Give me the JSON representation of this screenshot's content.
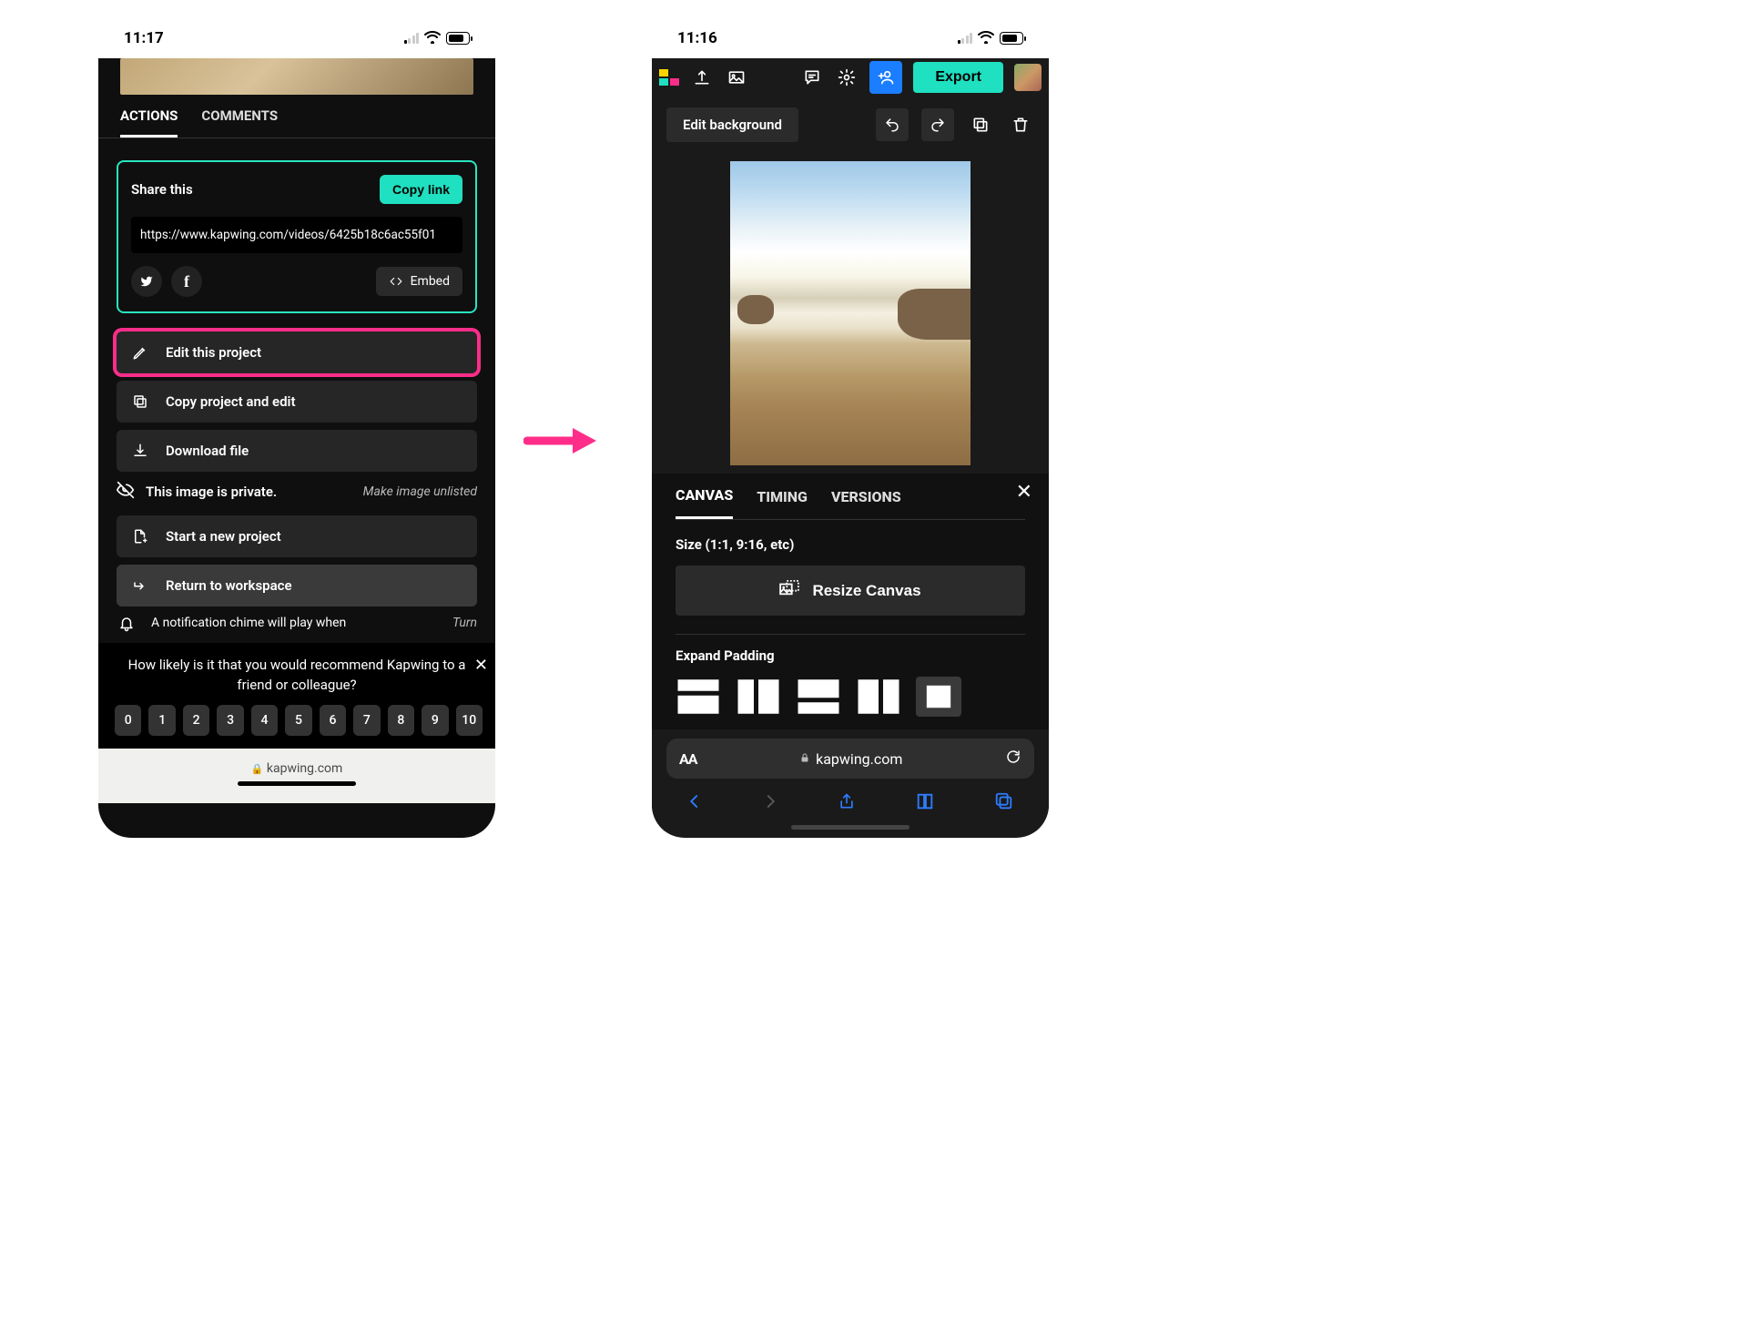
{
  "status_left": {
    "time": "11:17"
  },
  "status_right": {
    "time": "11:16"
  },
  "tabs": {
    "actions": "ACTIONS",
    "comments": "COMMENTS"
  },
  "share": {
    "title": "Share this",
    "copy": "Copy link",
    "url": "https://www.kapwing.com/videos/6425b18c6ac55f01",
    "embed": "Embed"
  },
  "actions": {
    "edit": "Edit this project",
    "copy_edit": "Copy project and edit",
    "download": "Download file",
    "private": "This image is private.",
    "unlisted": "Make image unlisted",
    "new_project": "Start a new project",
    "return": "Return to workspace",
    "notif": "A notification chime will play when",
    "turn": "Turn"
  },
  "survey": {
    "question": "How likely is it that you would recommend Kapwing to a friend or colleague?",
    "opts": [
      "0",
      "1",
      "2",
      "3",
      "4",
      "5",
      "6",
      "7",
      "8",
      "9",
      "10"
    ]
  },
  "browser_url": "kapwing.com",
  "right": {
    "export": "Export",
    "edit_bg": "Edit background",
    "panel_tabs": {
      "canvas": "CANVAS",
      "timing": "TIMING",
      "versions": "VERSIONS"
    },
    "size_label": "Size (1:1, 9:16, etc)",
    "resize": "Resize Canvas",
    "expand": "Expand Padding",
    "url": "kapwing.com",
    "aa": "AA"
  },
  "arrow_color": "#ff2d8a"
}
